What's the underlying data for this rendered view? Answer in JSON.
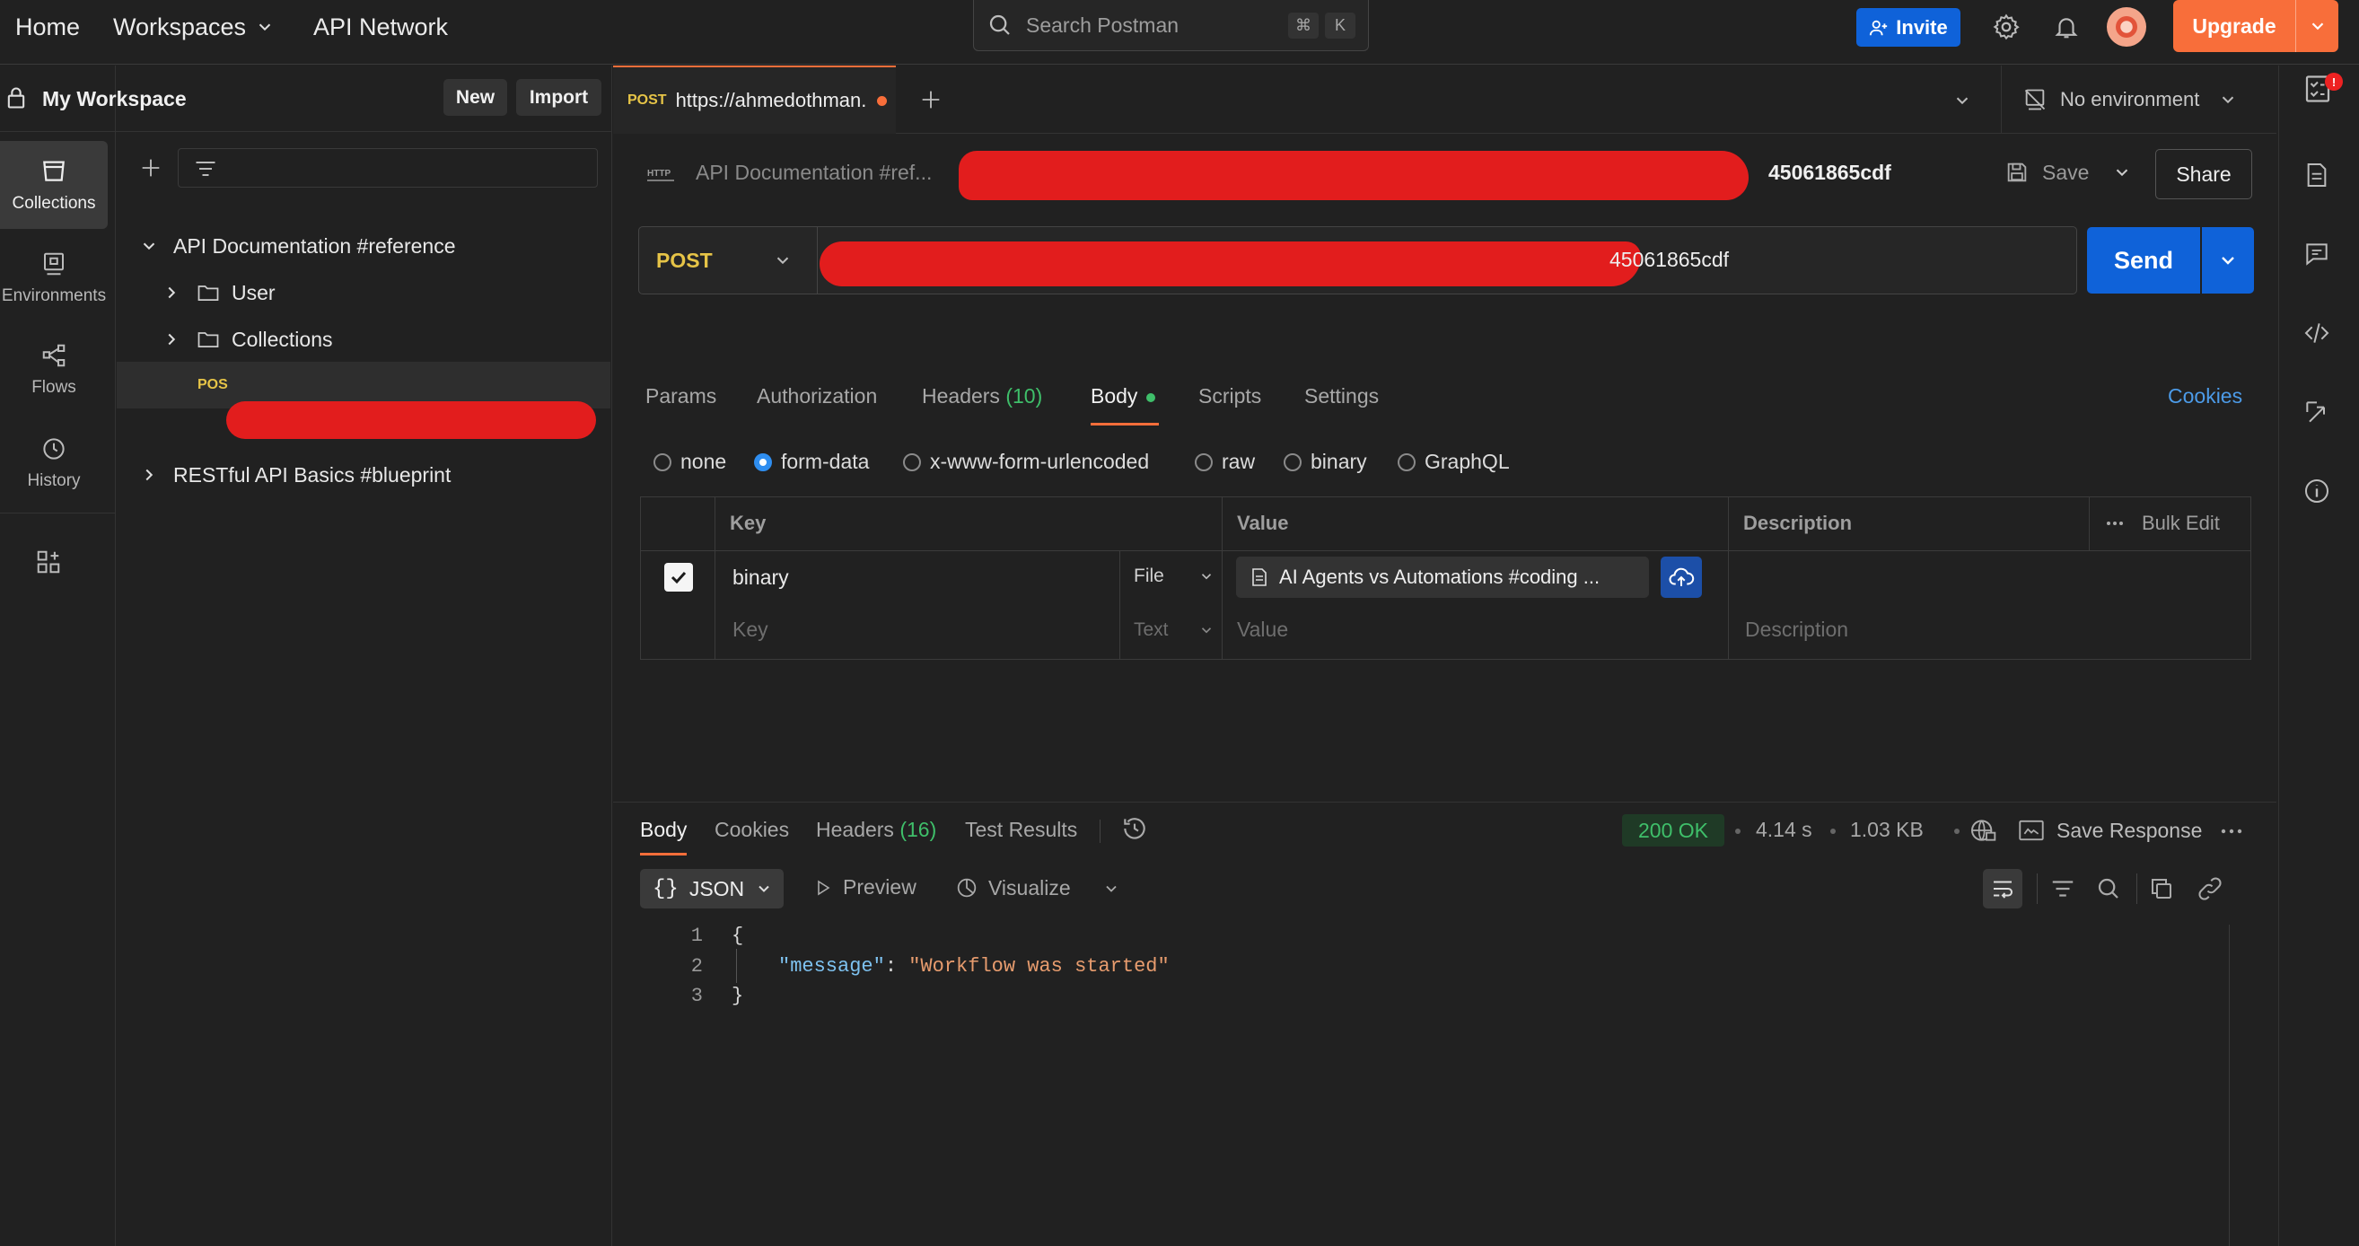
{
  "topbar": {
    "home": "Home",
    "workspaces": "Workspaces",
    "api_network": "API Network",
    "search_placeholder": "Search Postman",
    "kbd_cmd": "⌘",
    "kbd_k": "K",
    "invite": "Invite",
    "upgrade": "Upgrade"
  },
  "rail": {
    "collections": "Collections",
    "environments": "Environments",
    "flows": "Flows",
    "history": "History"
  },
  "sidebar": {
    "workspace": "My Workspace",
    "new": "New",
    "import": "Import",
    "tree": {
      "api_doc": "API Documentation #reference",
      "user": "User",
      "collections": "Collections",
      "post_method": "POS",
      "restful": "RESTful API Basics #blueprint"
    }
  },
  "request_tab": {
    "method": "POST",
    "url": "https://ahmedothman."
  },
  "environment": "No environment",
  "breadcrumb": {
    "collection": "API Documentation #ref...",
    "sep": "/",
    "name_tail": "45061865cdf"
  },
  "actions": {
    "save": "Save",
    "share": "Share",
    "send": "Send",
    "cookies": "Cookies"
  },
  "url_bar": {
    "method": "POST",
    "url_tail": "45061865cdf"
  },
  "req_tabs": {
    "params": "Params",
    "authorization": "Authorization",
    "headers": "Headers",
    "headers_count": "(10)",
    "body": "Body",
    "scripts": "Scripts",
    "settings": "Settings"
  },
  "body_types": {
    "none": "none",
    "form_data": "form-data",
    "urlencoded": "x-www-form-urlencoded",
    "raw": "raw",
    "binary": "binary",
    "graphql": "GraphQL"
  },
  "form_table": {
    "headers": {
      "key": "Key",
      "value": "Value",
      "description": "Description",
      "bulk_edit": "Bulk Edit"
    },
    "row1": {
      "key": "binary",
      "type": "File",
      "file": "AI Agents vs Automations #coding ..."
    },
    "row2": {
      "key_placeholder": "Key",
      "type": "Text",
      "value_placeholder": "Value",
      "description_placeholder": "Description"
    }
  },
  "response": {
    "tabs": {
      "body": "Body",
      "cookies": "Cookies",
      "headers": "Headers",
      "headers_count": "(16)",
      "test_results": "Test Results"
    },
    "status": "200 OK",
    "time": "4.14 s",
    "size": "1.03 KB",
    "save_response": "Save Response",
    "format": "JSON",
    "preview": "Preview",
    "visualize": "Visualize",
    "lines": [
      {
        "num": "1",
        "open": "{"
      },
      {
        "num": "2",
        "key": "\"message\"",
        "colon": ": ",
        "value": "\"Workflow was started\""
      },
      {
        "num": "3",
        "close": "}"
      }
    ]
  },
  "colors": {
    "accent_blue": "#0f62d9",
    "upgrade_orange": "#f86e3a",
    "status_green": "#3fbf6a",
    "redaction": "#e21d1d"
  }
}
